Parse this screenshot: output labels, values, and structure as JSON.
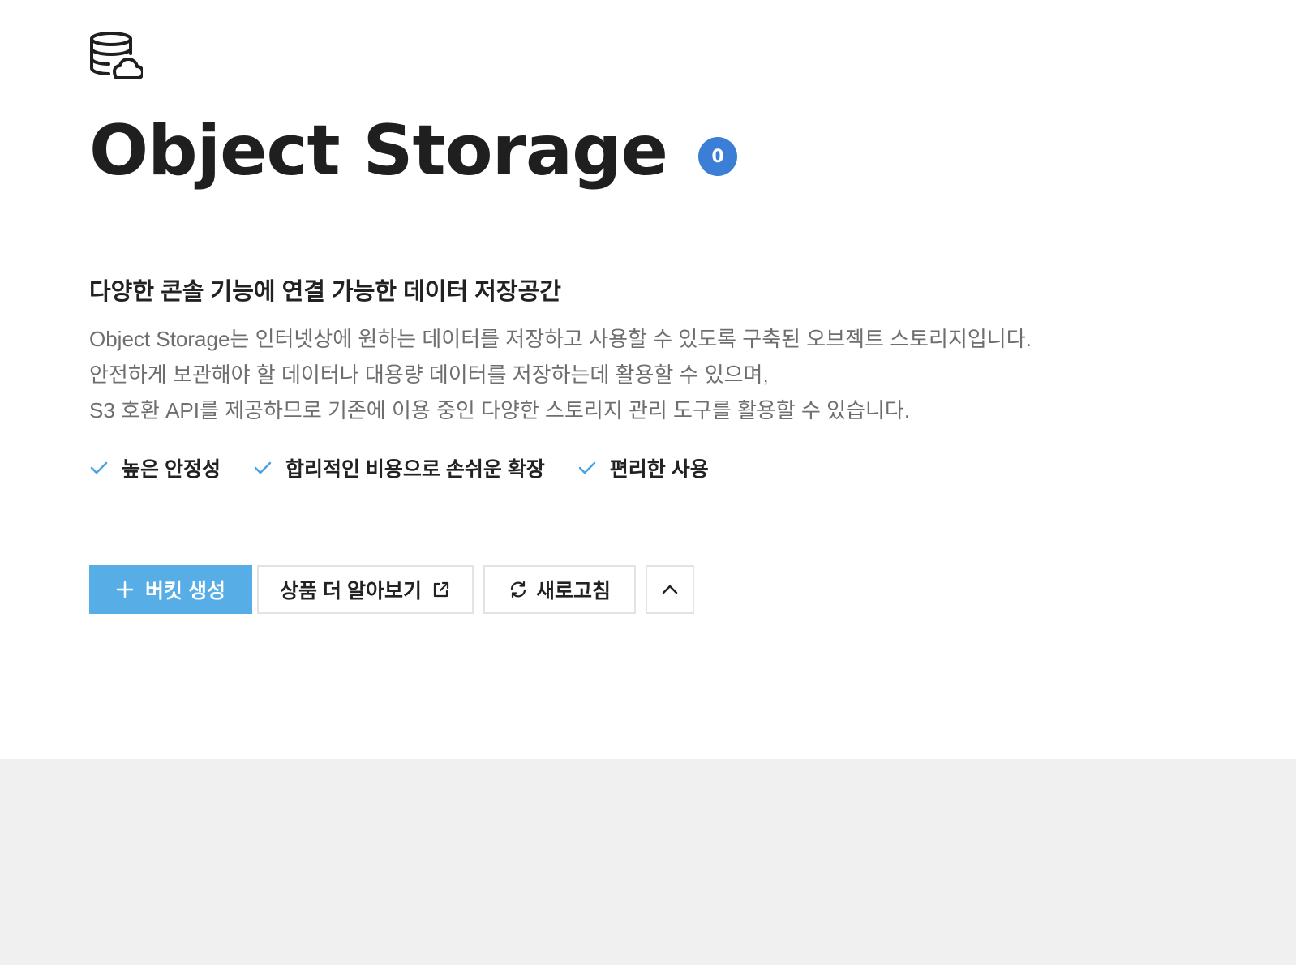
{
  "header": {
    "product_icon": "database-cloud-icon",
    "title": "Object Storage",
    "count_badge": "0"
  },
  "intro": {
    "subtitle": "다양한 콘솔 기능에 연결 가능한 데이터 저장공간",
    "description_lines": [
      "Object Storage는 인터넷상에 원하는 데이터를 저장하고 사용할 수 있도록 구축된 오브젝트 스토리지입니다.",
      "안전하게 보관해야 할 데이터나 대용량 데이터를 저장하는데 활용할 수 있으며,",
      "S3 호환 API를 제공하므로 기존에 이용 중인 다양한 스토리지 관리 도구를 활용할 수 있습니다."
    ]
  },
  "features": [
    {
      "icon": "check-icon",
      "label": "높은 안정성"
    },
    {
      "icon": "check-icon",
      "label": "합리적인 비용으로 손쉬운 확장"
    },
    {
      "icon": "check-icon",
      "label": "편리한 사용"
    }
  ],
  "toolbar": {
    "create_bucket_label": "버킷 생성",
    "create_bucket_icon": "plus-icon",
    "learn_more_label": "상품 더 알아보기",
    "learn_more_icon": "external-link-icon",
    "refresh_label": "새로고침",
    "refresh_icon": "refresh-icon",
    "collapse_icon": "chevron-up-icon"
  },
  "colors": {
    "primary_button": "#57ade6",
    "badge": "#3b7ed6",
    "check": "#4aa3df",
    "bottom_background": "#f0f0f0"
  }
}
